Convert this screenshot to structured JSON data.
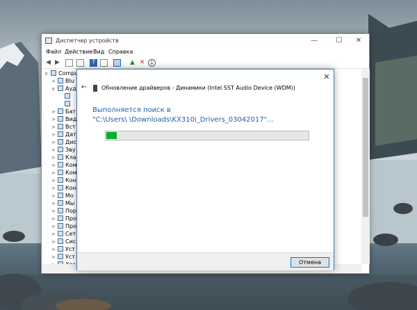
{
  "window": {
    "title": "Диспетчер устройств",
    "minimize_glyph": "—",
    "maximize_glyph": "☐",
    "close_glyph": "✕"
  },
  "menu": [
    "Файл",
    "Действие",
    "Вид",
    "Справка"
  ],
  "toolbar_icons": [
    "back-icon",
    "forward-icon",
    "properties-icon",
    "list-icon",
    "help-icon",
    "view-icon",
    "monitor-icon",
    "update-driver-icon",
    "uninstall-icon",
    "download-icon"
  ],
  "tree": {
    "root": "Compu",
    "items": [
      "Blu",
      "Ауд",
      "",
      "",
      "Бат",
      "Вид",
      "Вст",
      "Дат",
      "Дис",
      "Зву",
      "Кла",
      "Ком",
      "Ком",
      "Кон",
      "Кон",
      "Мо",
      "Мы",
      "Пор",
      "Про",
      "Про",
      "Сет",
      "Сис",
      "Уст",
      "Уст",
      "Хос"
    ]
  },
  "dialog": {
    "close_glyph": "✕",
    "back_glyph": "←",
    "title": "Обновление драйверов - Динамики (Intel SST Audio Device (WDM))",
    "searching_label": "Выполняется поиск в",
    "path": "\"C:\\Users\\          \\Downloads\\KX310i_Drivers_03042017\"...",
    "progress_percent": 5,
    "cancel_label": "Отмена"
  },
  "colors": {
    "accent_blue": "#1f5fa8",
    "progress_green": "#06b025",
    "dialog_border": "#3d7ac2"
  }
}
